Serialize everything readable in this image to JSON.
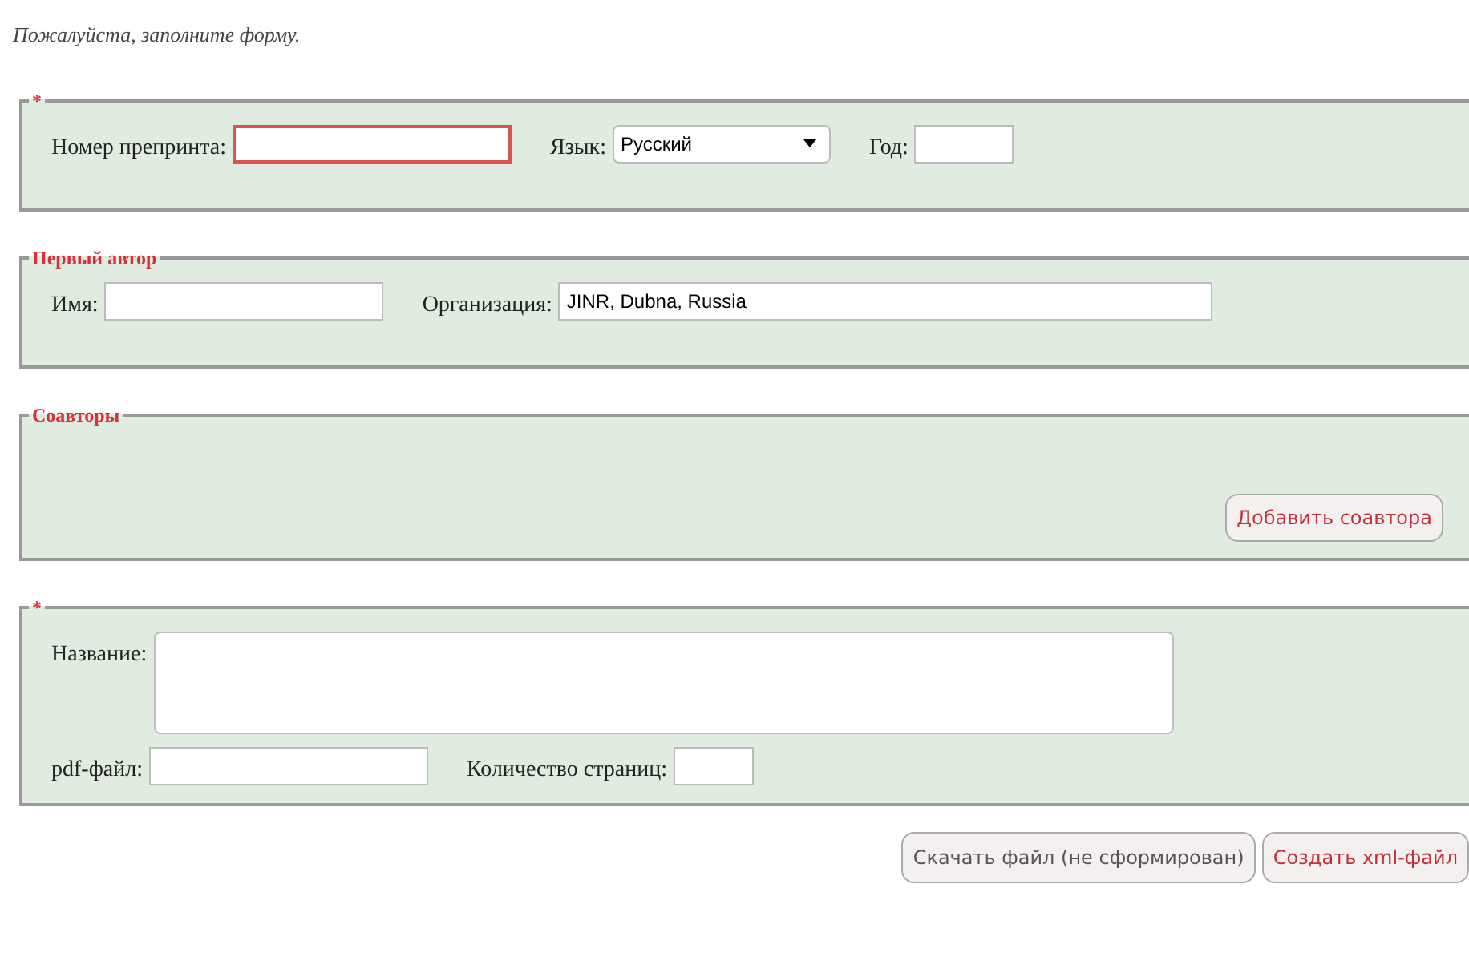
{
  "intro": "Пожалуйста, заполните форму.",
  "fieldsets": [
    {
      "legend": "*",
      "rows": [
        [
          {
            "kind": "text",
            "label": "Номер препринта:",
            "invalid": true
          },
          {
            "kind": "select",
            "label": "Язык:",
            "value": "Русский",
            "invalid": false
          },
          {
            "kind": "text",
            "label": "Год:",
            "invalid": false
          }
        ]
      ]
    },
    {
      "legend": "Первый автор",
      "rows": [
        [
          {
            "kind": "text",
            "label": "Имя:",
            "invalid": false
          },
          {
            "kind": "text",
            "label": "Организация:",
            "value": "JINR, Dubna, Russia",
            "invalid": false
          }
        ]
      ]
    },
    {
      "legend": "Соавторы",
      "button": "Добавить соавтора"
    },
    {
      "legend": "*",
      "rows": [
        [
          {
            "kind": "textarea",
            "label": "Название:",
            "invalid": false
          }
        ],
        [
          {
            "kind": "text",
            "label": "pdf-файл:",
            "invalid": false
          },
          {
            "kind": "text",
            "label": "Количество страниц:",
            "invalid": false
          }
        ]
      ]
    }
  ],
  "buttons": [
    {
      "label": "Скачать файл (не сформирован)",
      "disabled": true
    },
    {
      "label": "Создать xml-файл",
      "disabled": false
    }
  ]
}
